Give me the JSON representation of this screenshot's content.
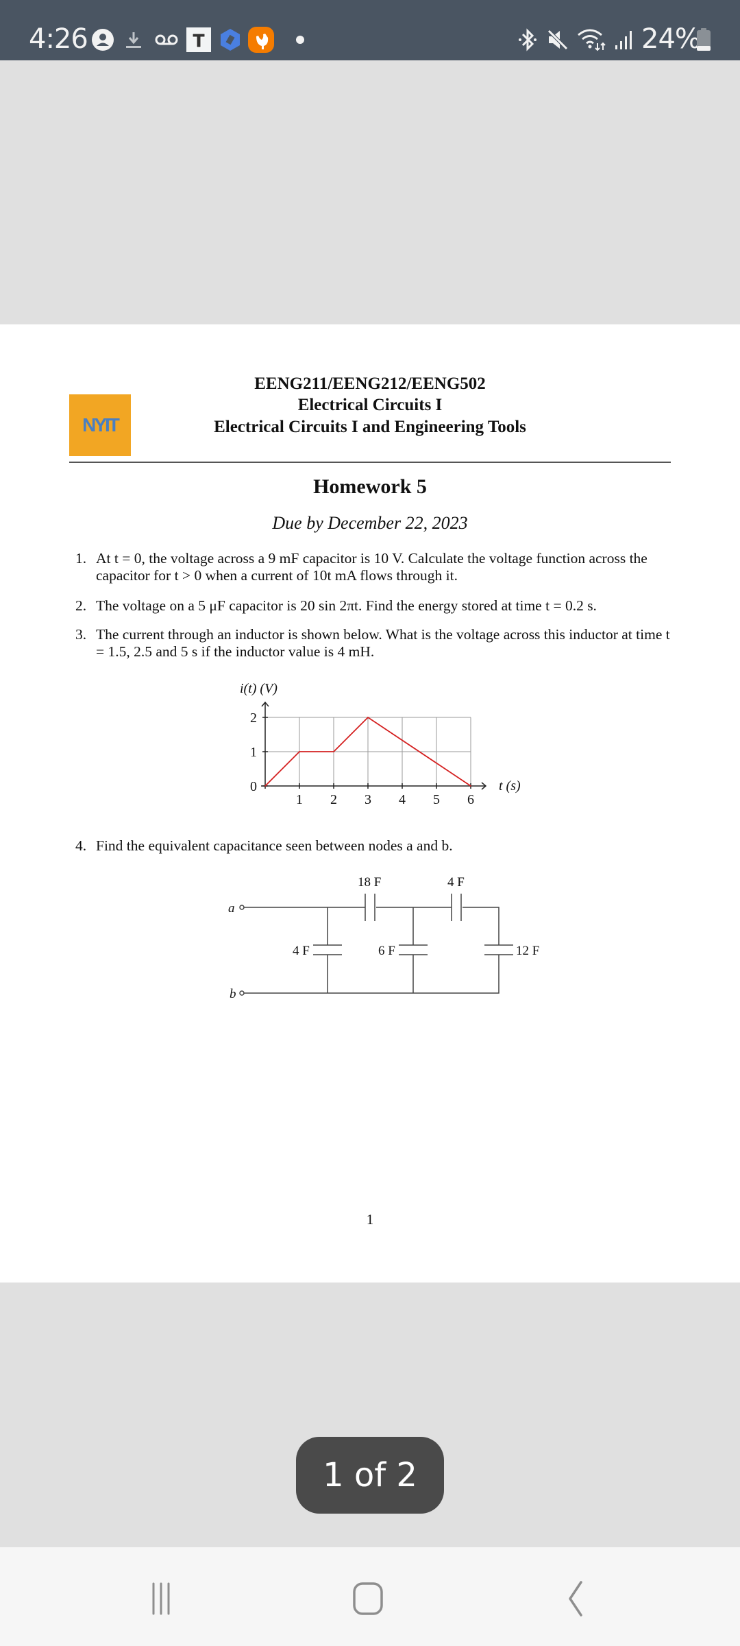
{
  "status_bar": {
    "time": "4:26",
    "left_icons": [
      "account-circle-icon",
      "download-icon",
      "voicemail-icon",
      "t-app-icon",
      "hexagon-app-icon",
      "rooster-app-icon",
      "more-dot-icon"
    ],
    "right_icons": [
      "bluetooth-icon",
      "mute-icon",
      "wifi-icon",
      "signal-icon",
      "battery-icon"
    ],
    "battery_percent": "24%",
    "battery_level": 0.24
  },
  "document": {
    "logo_text": "NYIT",
    "header": {
      "course_codes": "EENG211/EENG212/EENG502",
      "course_name": "Electrical Circuits I",
      "course_name_alt": "Electrical Circuits I and Engineering Tools"
    },
    "title": "Homework 5",
    "due": "Due by December 22, 2023",
    "questions": [
      {
        "num": "1.",
        "text": "At t = 0, the voltage across a 9 mF capacitor is 10 V. Calculate the voltage function across the capacitor for t > 0 when a current of 10t mA flows through it."
      },
      {
        "num": "2.",
        "text": "The voltage on a 5 μF capacitor is 20 sin 2πt. Find the energy stored at time t = 0.2 s."
      },
      {
        "num": "3.",
        "text": "The current through an inductor is shown below. What is the voltage across this inductor at time t = 1.5, 2.5 and 5 s if the inductor value is 4 mH."
      },
      {
        "num": "4.",
        "text": "Find the equivalent capacitance seen between nodes a and b."
      }
    ],
    "circuit": {
      "node_a": "a",
      "node_b": "b",
      "series_caps": [
        "18 F",
        "4 F"
      ],
      "shunt_caps": [
        "4 F",
        "6 F",
        "12 F"
      ]
    },
    "page_number": "1"
  },
  "chart_data": {
    "type": "line",
    "title": "",
    "xlabel": "t (s)",
    "ylabel": "i(t) (V)",
    "x": [
      0,
      1,
      2,
      3,
      6
    ],
    "series": [
      {
        "name": "i(t)",
        "values": [
          0,
          1,
          1,
          2,
          0
        ],
        "color": "#d42020"
      }
    ],
    "xticks": [
      "1",
      "2",
      "3",
      "4",
      "5",
      "6"
    ],
    "yticks": [
      "0",
      "1",
      "2"
    ],
    "xlim": [
      0,
      6
    ],
    "ylim": [
      0,
      2
    ],
    "grid": true
  },
  "viewer": {
    "page_indicator": "1 of 2"
  },
  "nav_bar": {
    "buttons": [
      "recents-button",
      "home-button",
      "back-button"
    ]
  }
}
